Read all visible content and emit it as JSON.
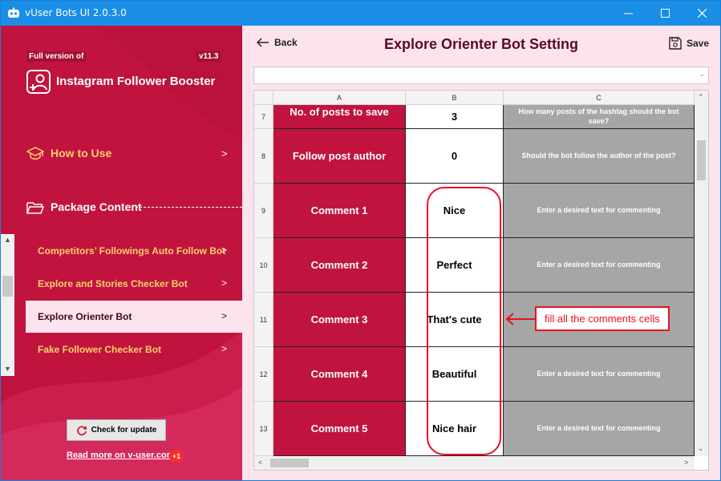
{
  "window": {
    "title": "vUser Bots UI 2.0.3.0"
  },
  "sidebar": {
    "full_version_label": "Full version of",
    "version": "v11.3",
    "product_name": "Instagram Follower Booster",
    "how_to_use": "How to Use",
    "package_content": "Package Content",
    "items": [
      {
        "label": "Competitors’ Followings Auto Follow Bot",
        "active": false
      },
      {
        "label": "Explore and Stories Checker Bot",
        "active": false
      },
      {
        "label": "Explore Orienter Bot",
        "active": true
      },
      {
        "label": "Fake Follower Checker Bot",
        "active": false
      }
    ],
    "check_update_label": "Check for update",
    "read_more_label": "Read more on v-user.com",
    "badge": "+1"
  },
  "header": {
    "back_label": "Back",
    "title": "Explore Orienter Bot Setting",
    "save_label": "Save"
  },
  "sheet": {
    "columns": [
      "A",
      "B",
      "C"
    ],
    "rows": [
      {
        "num": "7",
        "a": "No. of posts to save",
        "b": "3",
        "c": "How many posts of the hashtag should the bot save?"
      },
      {
        "num": "8",
        "a": "Follow post author",
        "b": "0",
        "c": "Should the bot follow the author of the post?"
      },
      {
        "num": "9",
        "a": "Comment 1",
        "b": "Nice",
        "c": "Enter a desired text for commenting"
      },
      {
        "num": "10",
        "a": "Comment 2",
        "b": "Perfect",
        "c": "Enter a desired text for commenting"
      },
      {
        "num": "11",
        "a": "Comment 3",
        "b": "That's cute",
        "c": ""
      },
      {
        "num": "12",
        "a": "Comment 4",
        "b": "Beautiful",
        "c": "Enter a desired text for commenting"
      },
      {
        "num": "13",
        "a": "Comment 5",
        "b": "Nice hair",
        "c": "Enter a desired text for commenting"
      }
    ]
  },
  "annotation": {
    "text": "fill all the comments cells"
  },
  "colors": {
    "accent": "#c0143f",
    "panel": "#fde3ee",
    "titlebar": "#1a8ee6",
    "annotation": "#e8131f"
  }
}
